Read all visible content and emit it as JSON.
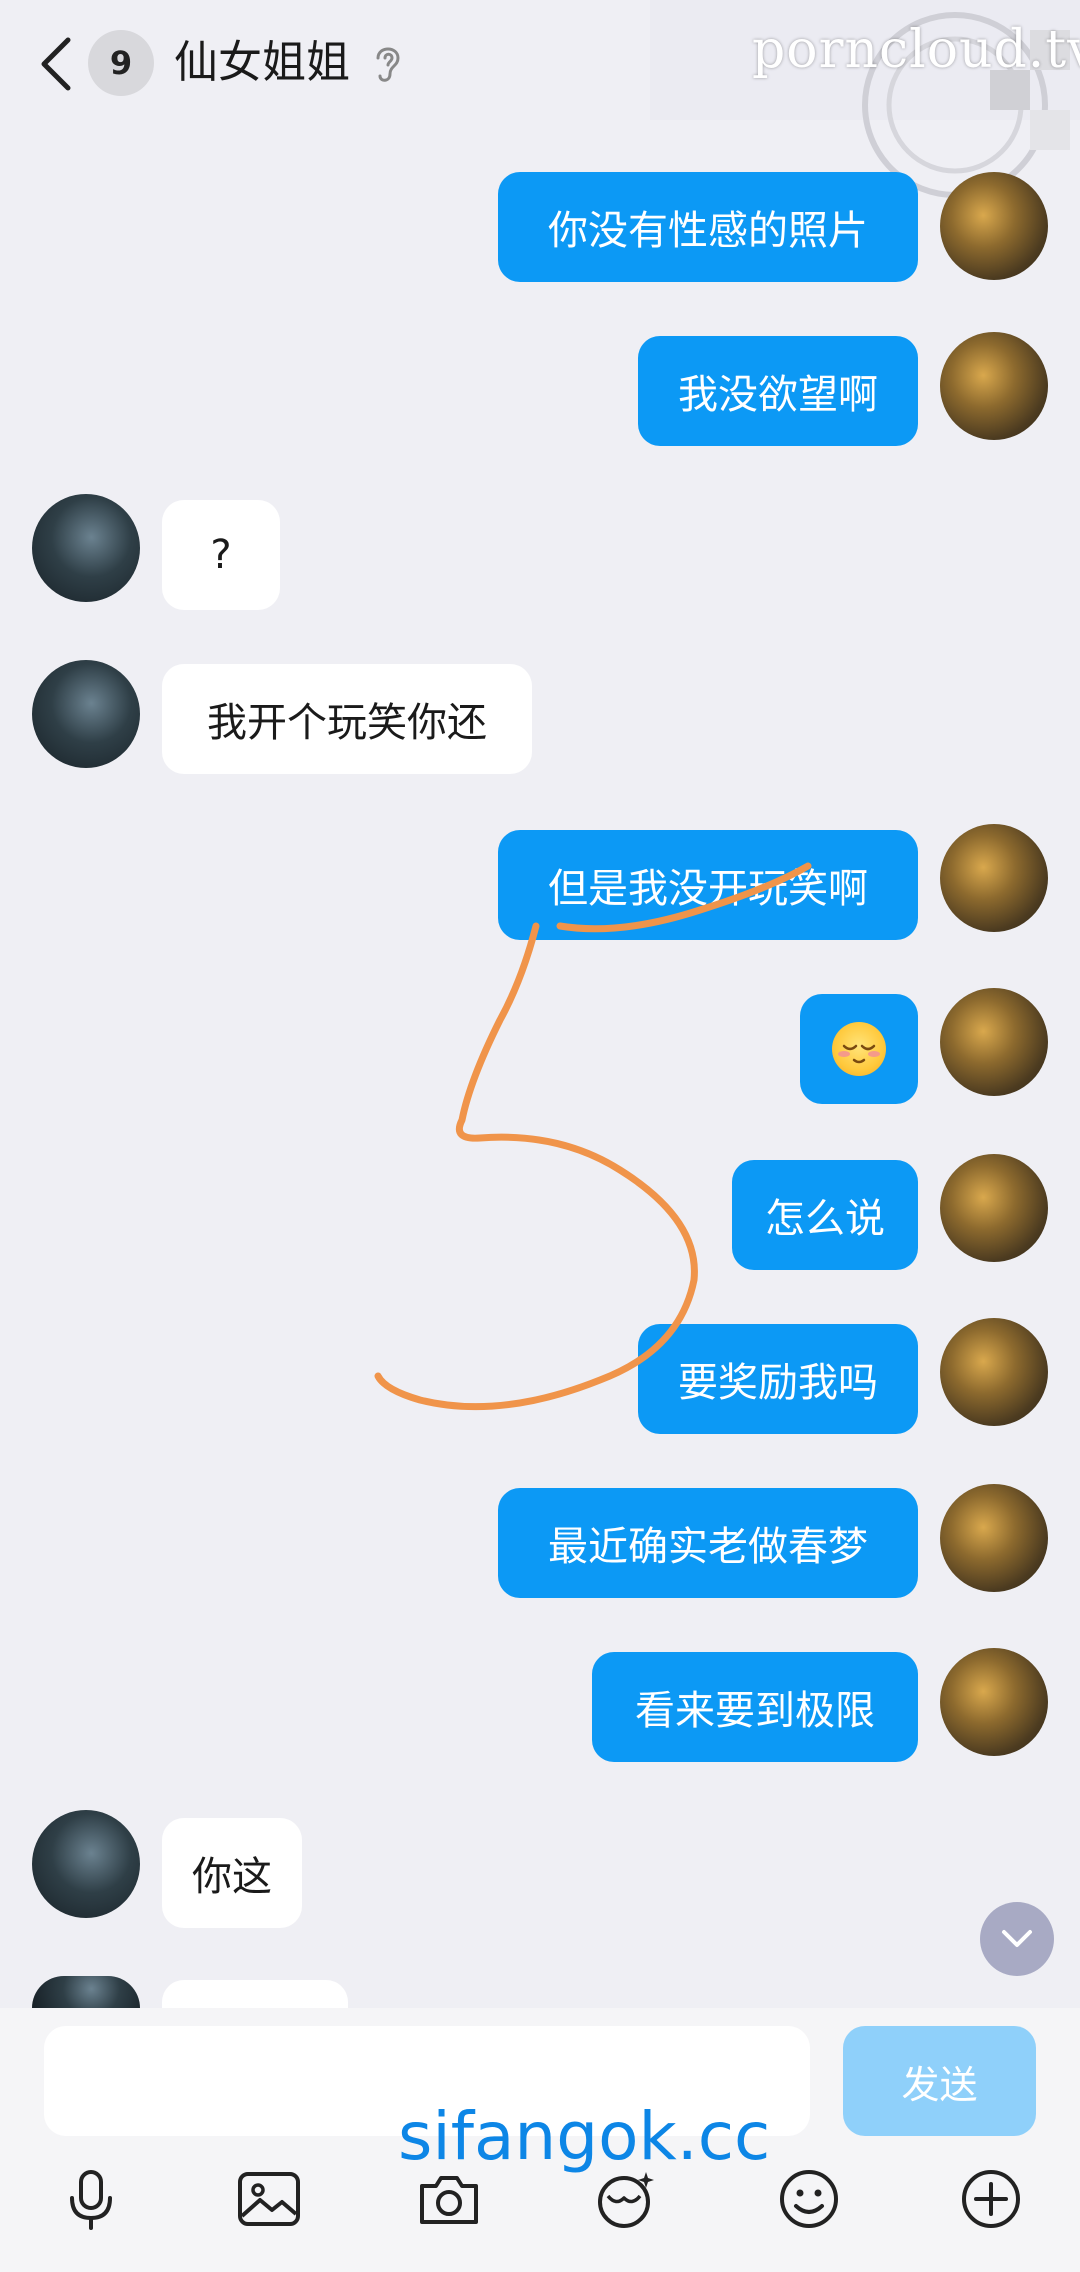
{
  "header": {
    "unread_count": "9",
    "title": "仙女姐姐"
  },
  "watermarks": {
    "top": "porncloud.tv",
    "bottom": "sifangok.cc"
  },
  "messages": [
    {
      "side": "out",
      "text": "你没有性感的照片"
    },
    {
      "side": "out",
      "text": "我没欲望啊"
    },
    {
      "side": "in",
      "text": "?"
    },
    {
      "side": "in",
      "text": "我开个玩笑你还"
    },
    {
      "side": "out",
      "text": "但是我没开玩笑啊"
    },
    {
      "side": "out",
      "text": "",
      "emoji": "relieved-face-emoji"
    },
    {
      "side": "out",
      "text": "怎么说"
    },
    {
      "side": "out",
      "text": "要奖励我吗"
    },
    {
      "side": "out",
      "text": "最近确实老做春梦"
    },
    {
      "side": "out",
      "text": "看来要到极限"
    },
    {
      "side": "in",
      "text": "你这"
    }
  ],
  "composer": {
    "send_label": "发送",
    "input_value": ""
  },
  "toolbar": {
    "icons": [
      "microphone-icon",
      "image-icon",
      "camera-icon",
      "sticker-icon",
      "emoji-icon",
      "plus-icon"
    ]
  },
  "colors": {
    "outgoing_bubble": "#0c99f5",
    "incoming_bubble": "#ffffff",
    "send_disabled": "#8fd0fa",
    "background": "#efeff4",
    "annotation_stroke": "#f0944a"
  }
}
